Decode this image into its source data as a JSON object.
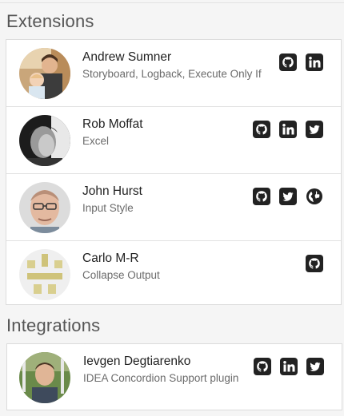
{
  "extensions": {
    "title": "Extensions",
    "people": [
      {
        "name": "Andrew Sumner",
        "description": "Storyboard, Logback, Execute Only If",
        "links": [
          "github",
          "linkedin"
        ]
      },
      {
        "name": "Rob Moffat",
        "description": "Excel",
        "links": [
          "github",
          "linkedin",
          "twitter"
        ]
      },
      {
        "name": "John Hurst",
        "description": "Input Style",
        "links": [
          "github",
          "twitter",
          "website"
        ]
      },
      {
        "name": "Carlo M-R",
        "description": "Collapse Output",
        "links": [
          "github"
        ]
      }
    ]
  },
  "integrations": {
    "title": "Integrations",
    "people": [
      {
        "name": "Ievgen Degtiarenko",
        "description": "IDEA Concordion Support plugin",
        "links": [
          "github",
          "linkedin",
          "twitter"
        ]
      }
    ]
  },
  "icon_names": {
    "github": "github-icon",
    "linkedin": "linkedin-icon",
    "twitter": "twitter-icon",
    "website": "globe-icon"
  },
  "colors": {
    "icon": "#222222",
    "background": "#f5f5f5",
    "card": "#ffffff",
    "border": "#dcdcdc"
  }
}
